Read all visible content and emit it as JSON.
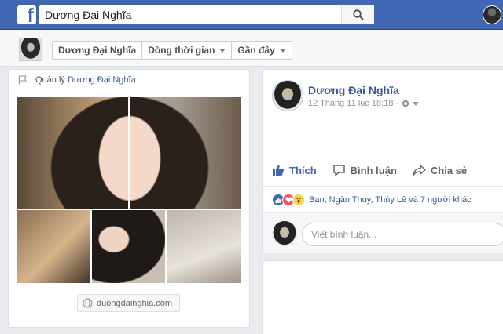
{
  "topbar": {
    "logo_letter": "f",
    "search_value": "Dương Đại Nghĩa",
    "colors": {
      "brand": "#4267b2",
      "link": "#365899",
      "background": "#e9ebee"
    }
  },
  "subnav": {
    "breadcrumbs": [
      {
        "label": "Dương Đại Nghĩa",
        "has_caret": false
      },
      {
        "label": "Dòng thời gian",
        "has_caret": true
      },
      {
        "label": "Gần đây",
        "has_caret": true
      }
    ]
  },
  "left_card": {
    "manage_prefix": "Quản lý",
    "manage_link": "Dương Đại Nghĩa",
    "website": "duongdainghia.com"
  },
  "post": {
    "author": "Dương Đại Nghĩa",
    "timestamp": "12 Tháng 11 lúc 18:18 ·",
    "actions": {
      "like": "Thích",
      "comment": "Bình luận",
      "share": "Chia sẻ"
    },
    "reactions_text": "Ban, Ngân Thuy, Thùy Lê và 7 người khác",
    "comment_placeholder": "Viết bình luận..."
  },
  "icons": [
    "facebook-logo",
    "search-icon",
    "flag-icon",
    "globe-icon",
    "like-icon",
    "comment-icon",
    "share-icon",
    "like-reaction",
    "love-reaction",
    "wow-reaction",
    "chevron-down-icon"
  ]
}
